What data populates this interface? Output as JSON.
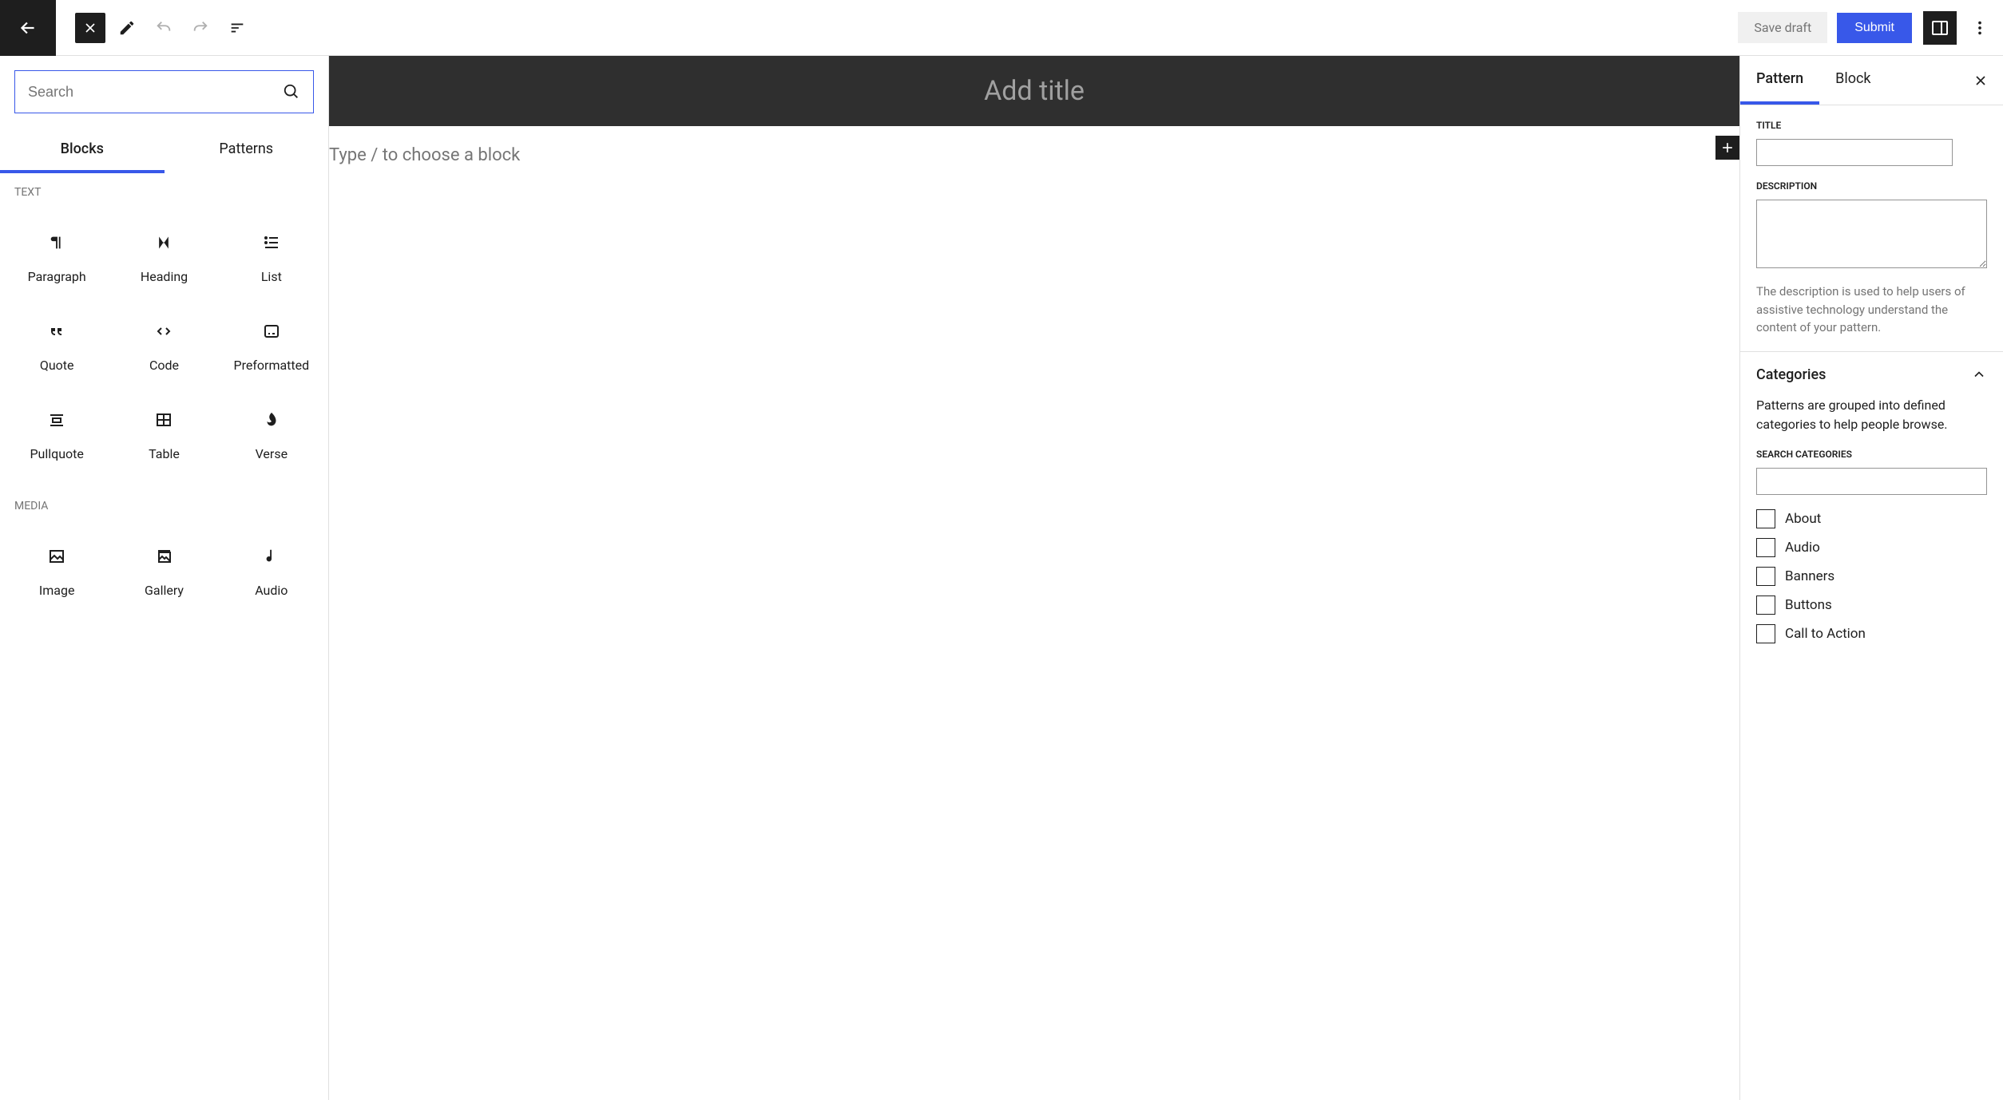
{
  "topbar": {
    "save_draft": "Save draft",
    "submit": "Submit"
  },
  "inserter": {
    "search_placeholder": "Search",
    "tabs": {
      "blocks": "Blocks",
      "patterns": "Patterns"
    },
    "sections": {
      "text": {
        "label": "TEXT",
        "items": [
          "Paragraph",
          "Heading",
          "List",
          "Quote",
          "Code",
          "Preformatted",
          "Pullquote",
          "Table",
          "Verse"
        ]
      },
      "media": {
        "label": "MEDIA",
        "items": [
          "Image",
          "Gallery",
          "Audio"
        ]
      }
    }
  },
  "canvas": {
    "title_placeholder": "Add title",
    "content_placeholder": "Type / to choose a block"
  },
  "sidebar": {
    "tabs": {
      "pattern": "Pattern",
      "block": "Block"
    },
    "title_label": "TITLE",
    "description_label": "DESCRIPTION",
    "description_help": "The description is used to help users of assistive technology understand the content of your pattern.",
    "categories": {
      "title": "Categories",
      "desc": "Patterns are grouped into defined categories to help people browse.",
      "search_label": "SEARCH CATEGORIES",
      "items": [
        "About",
        "Audio",
        "Banners",
        "Buttons",
        "Call to Action"
      ]
    }
  }
}
